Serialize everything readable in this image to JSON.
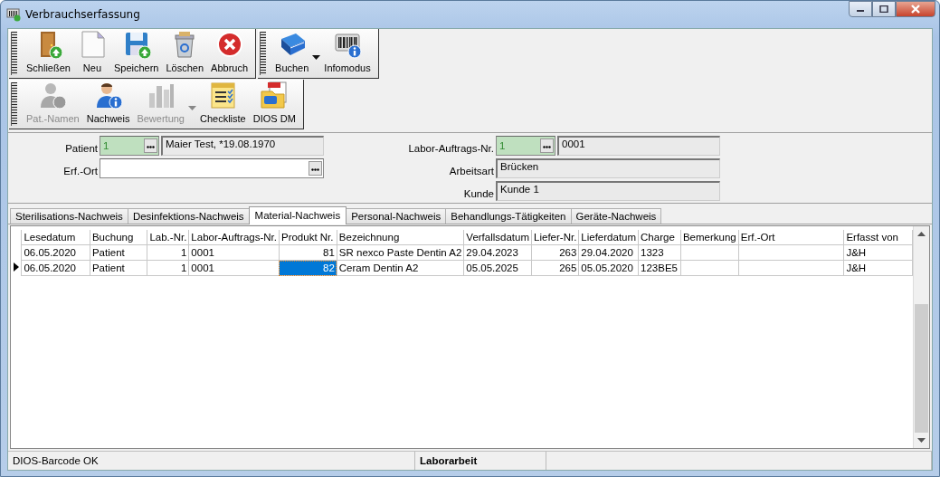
{
  "window": {
    "title": "Verbrauchserfassung"
  },
  "toolbars": [
    {
      "groups": [
        {
          "buttons": [
            {
              "label": "Schließen",
              "disabled": false,
              "dropdown": false
            },
            {
              "label": "Neu",
              "disabled": false,
              "dropdown": false
            },
            {
              "label": "Speichern",
              "disabled": false,
              "dropdown": false
            },
            {
              "label": "Löschen",
              "disabled": false,
              "dropdown": false
            },
            {
              "label": "Abbruch",
              "disabled": false,
              "dropdown": false
            }
          ]
        },
        {
          "buttons": [
            {
              "label": "Buchen",
              "disabled": false,
              "dropdown": true
            },
            {
              "label": "Infomodus",
              "disabled": false,
              "dropdown": false
            }
          ]
        }
      ]
    },
    {
      "groups": [
        {
          "buttons": [
            {
              "label": "Pat.-Namen",
              "disabled": true,
              "dropdown": false
            },
            {
              "label": "Nachweis",
              "disabled": false,
              "dropdown": false
            },
            {
              "label": "Bewertung",
              "disabled": true,
              "dropdown": true
            },
            {
              "label": "Checkliste",
              "disabled": false,
              "dropdown": false
            },
            {
              "label": "DIOS DM",
              "disabled": false,
              "dropdown": false
            }
          ]
        }
      ]
    }
  ],
  "form": {
    "left": [
      {
        "label": "Patient",
        "kind": "lookup",
        "code": "1",
        "value": "Maier Test, *19.08.1970"
      },
      {
        "label": "Erf.-Ort",
        "kind": "picker"
      }
    ],
    "right": [
      {
        "label": "Labor-Auftrags-Nr.",
        "kind": "lookup",
        "code": "1",
        "value": "0001"
      },
      {
        "label": "Arbeitsart",
        "kind": "text",
        "value": "Brücken"
      },
      {
        "label": "Kunde",
        "kind": "text",
        "value": "Kunde 1"
      }
    ]
  },
  "tabs": [
    {
      "label": "Sterilisations-Nachweis",
      "selected": false
    },
    {
      "label": "Desinfektions-Nachweis",
      "selected": false
    },
    {
      "label": "Material-Nachweis",
      "selected": true
    },
    {
      "label": "Personal-Nachweis",
      "selected": false
    },
    {
      "label": "Behandlungs-Tätigkeiten",
      "selected": false
    },
    {
      "label": "Geräte-Nachweis",
      "selected": false
    }
  ],
  "table": {
    "columns": [
      {
        "label": "Lesedatum",
        "kind": "text",
        "current": false
      },
      {
        "label": "Buchung",
        "kind": "text",
        "current": false
      },
      {
        "label": "Lab.-Nr.",
        "kind": "number",
        "current": false
      },
      {
        "label": "Labor-Auftrags-Nr.",
        "kind": "text",
        "current": false
      },
      {
        "label": "Produkt Nr.",
        "kind": "number",
        "current": true
      },
      {
        "label": "Bezeichnung",
        "kind": "text",
        "current": false
      },
      {
        "label": "Verfallsdatum",
        "kind": "text",
        "current": false
      },
      {
        "label": "Liefer-Nr.",
        "kind": "number",
        "current": false
      },
      {
        "label": "Lieferdatum",
        "kind": "text",
        "current": false
      },
      {
        "label": "Charge",
        "kind": "text",
        "current": false
      },
      {
        "label": "Bemerkung",
        "kind": "text",
        "current": false
      },
      {
        "label": "Erf.-Ort",
        "kind": "text",
        "current": false
      },
      {
        "label": "Erfasst von",
        "kind": "text",
        "current": false
      }
    ],
    "rows": [
      {
        "selected": false,
        "cells": [
          "06.05.2020",
          "Patient",
          "1",
          "0001",
          "81",
          "SR nexco Paste Dentin A2",
          "29.04.2023",
          "263",
          "29.04.2020",
          "1323",
          "",
          "",
          "J&H"
        ]
      },
      {
        "selected": true,
        "cells": [
          "06.05.2020",
          "Patient",
          "1",
          "0001",
          "82",
          "Ceram Dentin A2",
          "05.05.2025",
          "265",
          "05.05.2020",
          "123BE5",
          "",
          "",
          "J&H"
        ]
      }
    ]
  },
  "status_bar": [
    {
      "text": "DIOS-Barcode OK",
      "bold": false
    },
    {
      "text": "Laborarbeit",
      "bold": true
    }
  ]
}
